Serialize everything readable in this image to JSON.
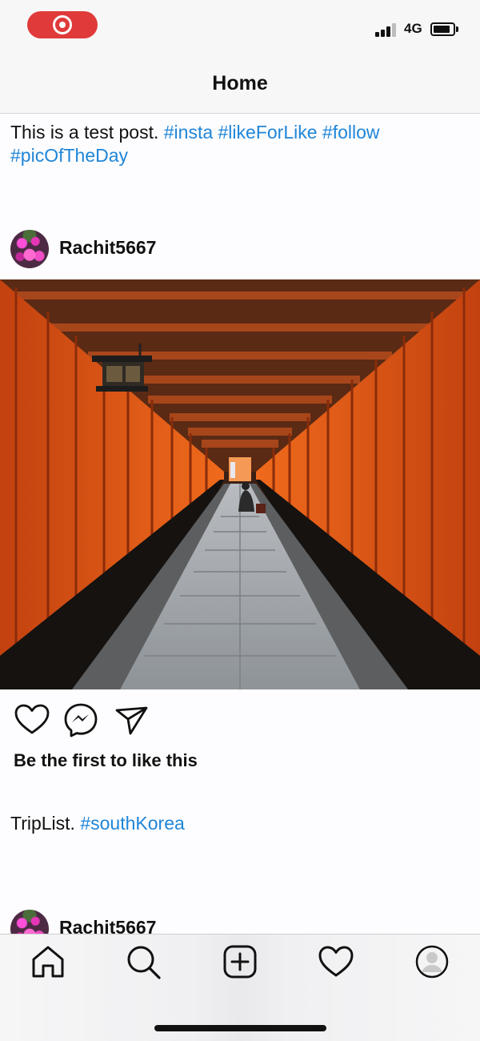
{
  "status_bar": {
    "network": "4G",
    "record_indicator": "screen-recording",
    "colors": {
      "record": "#e03a3a"
    }
  },
  "header": {
    "title": "Home"
  },
  "posts": [
    {
      "caption_text": "This is a test post.",
      "hashtags_line1": "#insta #likeForLike #follow",
      "hashtags_line2": "#picOfTheDay"
    },
    {
      "username": "Rachit5667",
      "image": "torii-gates-path-photo",
      "actions": [
        "heart-icon",
        "messenger-icon",
        "send-icon"
      ],
      "likes_text": "Be the first to like this",
      "caption_text": "TripList.",
      "hashtags": "#southKorea"
    },
    {
      "username": "Rachit5667"
    }
  ],
  "tab_bar": {
    "items": [
      "home-icon",
      "search-icon",
      "add-post-icon",
      "activity-heart-icon",
      "profile-icon"
    ]
  },
  "colors": {
    "hashtag": "#1f86d8",
    "accent_torii": "#e0541a"
  }
}
